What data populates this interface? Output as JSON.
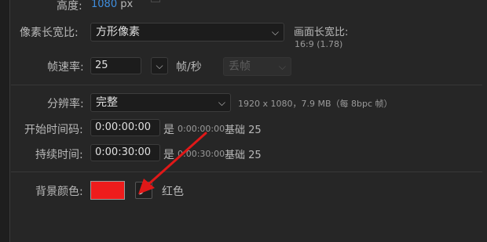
{
  "height": {
    "label": "高度:",
    "value": "1080",
    "unit": "px"
  },
  "pixel_aspect": {
    "label": "像素长宽比:",
    "selected": "方形像素"
  },
  "frame_aspect": {
    "label": "画面长宽比:",
    "value": "16:9 (1.78)"
  },
  "frame_rate": {
    "label": "帧速率:",
    "value": "25",
    "unit": "帧/秒",
    "drop_frame": "丢帧"
  },
  "resolution": {
    "label": "分辨率:",
    "selected": "完整",
    "info": "1920 x 1080，7.9 MB（每 8bpc 帧）"
  },
  "start_timecode": {
    "label": "开始时间码:",
    "value": "0:00:00:00",
    "is_text": "是",
    "is_value": "0:00:00:00",
    "base_text": "基础 25"
  },
  "duration": {
    "label": "持续时间:",
    "value": "0:00:30:00",
    "is_text": "是",
    "is_value": "0:00:30:00",
    "base_text": "基础 25"
  },
  "background": {
    "label": "背景颜色:",
    "color_name": "红色",
    "swatch_color": "#ee1c1c"
  },
  "annotation": {
    "arrow_color": "#e01818"
  }
}
